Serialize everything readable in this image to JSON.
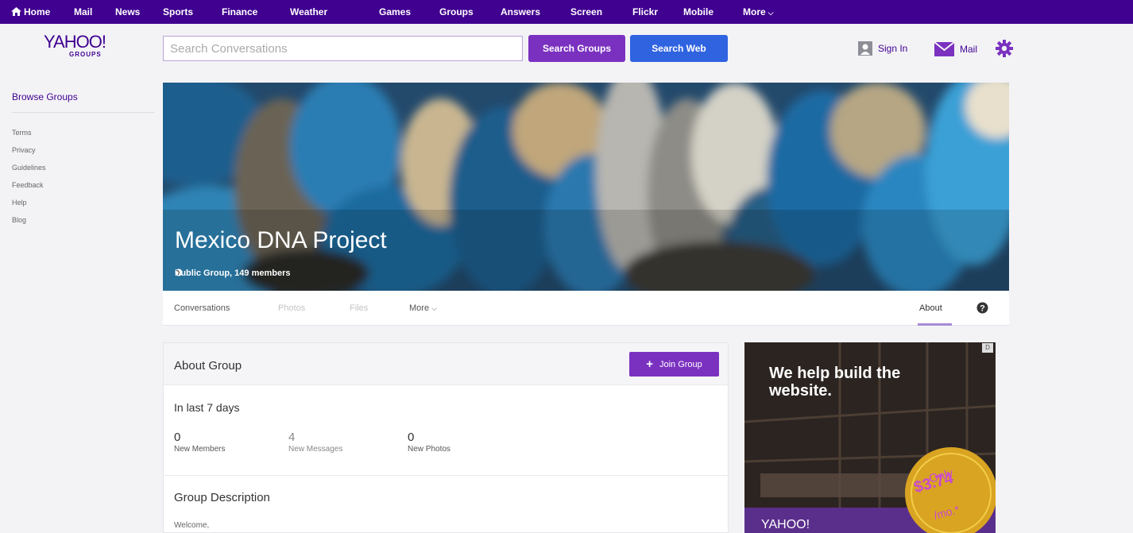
{
  "topnav": {
    "items": [
      "Home",
      "Mail",
      "News",
      "Sports",
      "Finance",
      "Weather",
      "Games",
      "Groups",
      "Answers",
      "Screen",
      "Flickr",
      "Mobile",
      "More"
    ]
  },
  "logo": {
    "word": "YAHOO!",
    "sub": "GROUPS"
  },
  "search": {
    "placeholder": "Search Conversations",
    "groups_label": "Search Groups",
    "web_label": "Search Web"
  },
  "user": {
    "signin_label": "Sign In",
    "mail_label": "Mail"
  },
  "sidebar": {
    "browse": "Browse Groups",
    "links": [
      "Terms",
      "Privacy",
      "Guidelines",
      "Feedback",
      "Help",
      "Blog"
    ]
  },
  "cover": {
    "title": "Mexico DNA Project",
    "meta": "Public Group, 149 members"
  },
  "tabs": {
    "conversations": "Conversations",
    "photos": "Photos",
    "files": "Files",
    "more": "More",
    "about": "About"
  },
  "about": {
    "title": "About Group",
    "join_label": "Join Group",
    "last7": "In last 7 days",
    "stats": [
      {
        "value": "0",
        "label": "New Members"
      },
      {
        "value": "4",
        "label": "New Messages"
      },
      {
        "value": "0",
        "label": "New Photos"
      }
    ],
    "desc_title": "Group Description",
    "welcome": "Welcome,"
  },
  "ad": {
    "headline": "We help build the website.",
    "only": "Only",
    "price": "$3.74",
    "per": "/mo.*",
    "brand": "YAHOO!",
    "badge": "D"
  },
  "colors": {
    "brand_purple": "#400090",
    "button_purple": "#7b31c0",
    "button_blue": "#2f63e0"
  }
}
